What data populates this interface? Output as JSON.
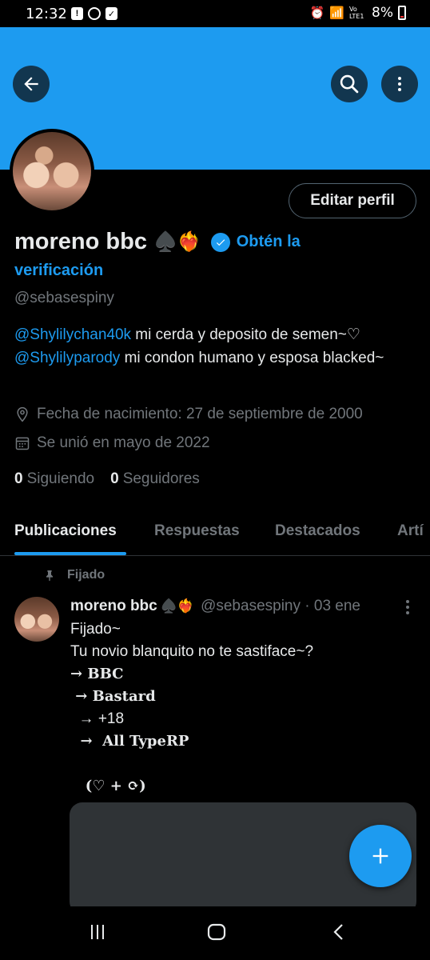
{
  "status_bar": {
    "time": "12:32",
    "battery": "8%",
    "network": "Vo LTE1"
  },
  "profile": {
    "display_name": "moreno bbc",
    "name_emojis": "♠️❤️‍🔥",
    "get_verified_line1": "Obtén la",
    "get_verified_line2": "verificación",
    "handle": "@sebasespiny",
    "edit_button": "Editar perfil",
    "bio": {
      "mention1": "@Shylilychan40k",
      "text1": " mi cerda y deposito de semen~♡",
      "mention2": "@Shylilyparody",
      "text2": " mi condon humano y esposa blacked~"
    },
    "birth": "Fecha de nacimiento: 27 de septiembre de 2000",
    "joined": "Se unió en mayo de 2022",
    "following_count": "0",
    "following_label": "Siguiendo",
    "followers_count": "0",
    "followers_label": "Seguidores"
  },
  "tabs": [
    "Publicaciones",
    "Respuestas",
    "Destacados",
    "Artí"
  ],
  "active_tab": "Publicaciones",
  "pinned_post": {
    "pinned_label": "Fijado",
    "author_name": "moreno bbc",
    "author_emojis": "♠️❤️‍🔥",
    "handle_date": "@sebasespiny · 03 ene",
    "lines": [
      "Fijado~",
      "Tu novio blanquito no te sastiface~?"
    ],
    "fancy_lines": [
      "→ BBC",
      " → Bastard",
      "  → +18",
      "  →  All TypeRP",
      "",
      "   (♡ + ⟳)"
    ]
  },
  "colors": {
    "accent": "#1d9bf0",
    "background": "#000000",
    "text": "#e7e9ea",
    "muted": "#71767b"
  }
}
